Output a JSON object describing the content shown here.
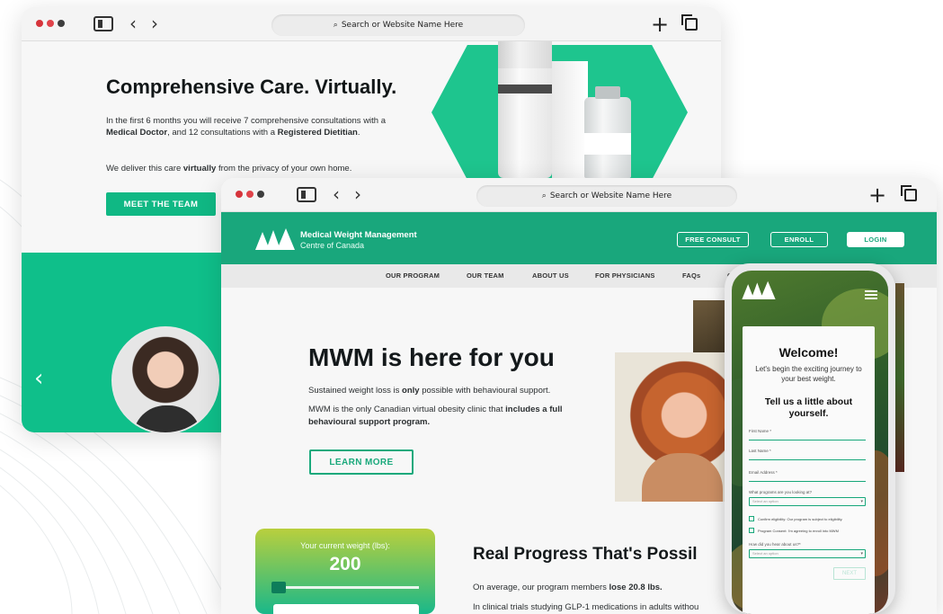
{
  "back_window": {
    "url_placeholder": "Search or Website Name Here",
    "heading": "Comprehensive Care. Virtually.",
    "para1_pre": "In the first 6 months you will receive 7 comprehensive consultations with a ",
    "para1_b1": "Medical Doctor",
    "para1_mid": ", and 12 consultations with a ",
    "para1_b2": "Registered Dietitian",
    "para1_end": ".",
    "para2_pre": "We deliver this care ",
    "para2_b": "virtually",
    "para2_end": " from the privacy of your own home.",
    "team_button": "MEET THE TEAM",
    "prev_arrow": "‹"
  },
  "front_window": {
    "url_placeholder": "Search or Website Name Here",
    "brand_line1": "Medical Weight Management",
    "brand_line2": "Centre of Canada",
    "header_buttons": [
      "FREE CONSULT",
      "ENROLL",
      "LOGIN"
    ],
    "menu": [
      "OUR PROGRAM",
      "OUR TEAM",
      "ABOUT US",
      "FOR PHYSICIANS",
      "FAQs",
      "C"
    ],
    "heading": "MWM is here for you",
    "p1_pre": "Sustained weight loss is ",
    "p1_b": "only",
    "p1_end": " possible with behavioural support.",
    "p2_pre": "MWM is the only Canadian virtual obesity clinic that ",
    "p2_b": "includes a full behavioural support program.",
    "learn_button": "LEARN MORE",
    "weight_label": "Your current weight (lbs):",
    "weight_value": "200",
    "weight_slider_fraction": 0.0,
    "progress_heading": "Real Progress That's Possil",
    "progress_p1_pre": "On average, our program members ",
    "progress_p1_b": "lose 20.8 lbs.",
    "progress_p2": "In clinical trials studying GLP-1 medications in adults withou"
  },
  "phone": {
    "welcome": "Welcome!",
    "subtitle": "Let's begin the exciting journey to your best weight.",
    "tell_us": "Tell us a little about yourself.",
    "fields": [
      "First Name *",
      "Last Name *",
      "Email Address *"
    ],
    "question1": "What programs are you looking at?",
    "select1_placeholder": "Select an option",
    "checks": [
      "Confirm eligibility: Our program is subject to eligibility.",
      "Program Consent: I'm agreeing to enroll into MWM"
    ],
    "question2": "How did you hear about us?*",
    "select2_placeholder": "Select an option",
    "next_button": "NEXT"
  },
  "colors": {
    "brand_green": "#19a77c",
    "accent_green": "#10b884",
    "gradient_top": "#b9cf3d"
  },
  "icons": [
    "window-close-dot",
    "sidebar-icon",
    "back-arrow-icon",
    "forward-arrow-icon",
    "search-icon",
    "new-tab-plus-icon",
    "tabs-icon",
    "hamburger-menu-icon",
    "logo-mark"
  ]
}
